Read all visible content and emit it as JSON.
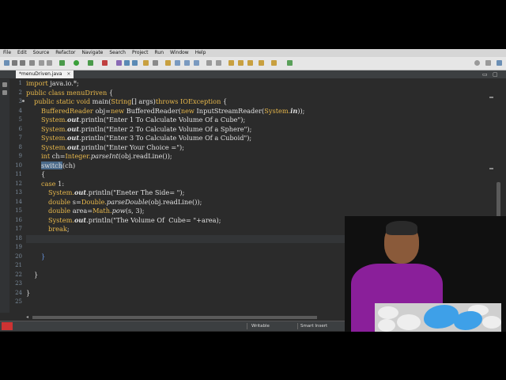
{
  "menu": [
    "File",
    "Edit",
    "Source",
    "Refactor",
    "Navigate",
    "Search",
    "Project",
    "Run",
    "Window",
    "Help"
  ],
  "editor_tab": {
    "label": "*menuDriven.java",
    "close": "×"
  },
  "window_controls": {
    "minimize": "▭",
    "maximize": "▢"
  },
  "line_numbers": [
    "1",
    "2",
    "3",
    "4",
    "5",
    "6",
    "7",
    "8",
    "9",
    "10",
    "11",
    "12",
    "13",
    "14",
    "15",
    "16",
    "17",
    "18",
    "19",
    "20",
    "21",
    "22",
    "23",
    "24",
    "25"
  ],
  "code": {
    "l1_kw": "import",
    "l1_rest": " java.io.*;",
    "l2_kw": "public class",
    "l2_cls": " menuDriven",
    "l2_rest": " {",
    "l3_kw": "public static void",
    "l3_m": " main(",
    "l3_type": "String",
    "l3_rest": "[] args)",
    "l3_kw2": "throws",
    "l3_exc": " IOException",
    "l3_end": " {",
    "l4_a": "BufferedReader",
    "l4_b": " obj=",
    "l4_c": "new",
    "l4_d": " BufferedReader(",
    "l4_e": "new",
    "l4_f": " InputStreamReader(",
    "l4_g": "System.",
    "l4_h": "in",
    "l4_i": "));",
    "l5_a": "System.",
    "l5_b": "out",
    "l5_c": ".println(\"Enter 1 To Calculate Volume Of a Cube\");",
    "l6_a": "System.",
    "l6_b": "out",
    "l6_c": ".println(\"Enter 2 To Calculate Volume Of a Sphere\");",
    "l7_a": "System.",
    "l7_b": "out",
    "l7_c": ".println(\"Enter 3 To Calculate Volume Of a Cuboid\");",
    "l8_a": "System.",
    "l8_b": "out",
    "l8_c": ".println(\"Enter Your Choice =\");",
    "l9_a": "int",
    "l9_b": " ch=",
    "l9_c": "Integer.",
    "l9_d": "parseInt",
    "l9_e": "(obj.readLine());",
    "l10_a": "switch",
    "l10_b": "(ch)",
    "l11": "{",
    "l12_a": "case",
    "l12_b": " 1:",
    "l13_a": "System.",
    "l13_b": "out",
    "l13_c": ".println(\"Eneter The Side= \");",
    "l14_a": "double",
    "l14_b": " s=",
    "l14_c": "Double.",
    "l14_d": "parseDouble",
    "l14_e": "(obj.readLine());",
    "l15_a": "double",
    "l15_b": " area=",
    "l15_c": "Math.",
    "l15_d": "pow",
    "l15_e": "(s, 3);",
    "l16_a": "System.",
    "l16_b": "out",
    "l16_c": ".println(\"The Volume Of  Cube= \"+area);",
    "l17_a": "break",
    "l17_b": ";",
    "l20": "}",
    "l22": "}",
    "l24": "}"
  },
  "status": {
    "writable": "Writable",
    "insert_mode": "Smart Insert"
  }
}
